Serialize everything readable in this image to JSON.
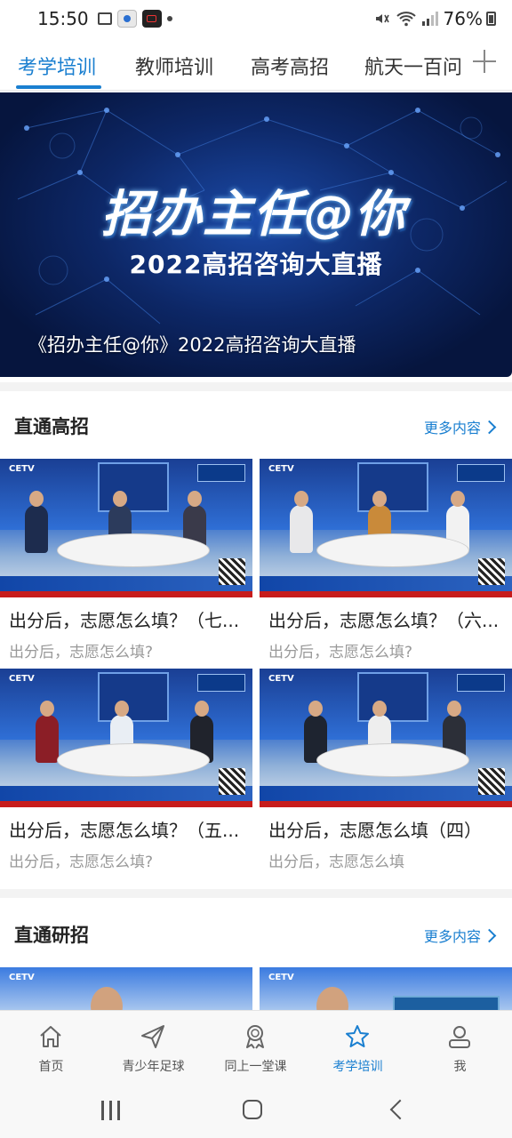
{
  "status_bar": {
    "time": "15:50",
    "battery": "76%",
    "icons": [
      "gallery-icon",
      "camera-app-icon",
      "screen-record-icon",
      "dot-icon",
      "mute-icon",
      "wifi-icon",
      "signal-icon",
      "battery-icon"
    ]
  },
  "tabs": {
    "items": [
      {
        "label": "考学培训",
        "active": true
      },
      {
        "label": "教师培训",
        "active": false
      },
      {
        "label": "高考高招",
        "active": false
      },
      {
        "label": "航天一百问",
        "active": false
      }
    ],
    "add_icon": "plus-icon",
    "accent": "#1a7fd0"
  },
  "banner": {
    "logo_text": "招办主任@你",
    "subtitle": "2022高招咨询大直播",
    "caption": "《招办主任@你》2022高招咨询大直播"
  },
  "sections": [
    {
      "title": "直通高招",
      "more_label": "更多内容",
      "cards": [
        {
          "title": "出分后，志愿怎么填？（七...",
          "subtitle": "出分后，志愿怎么填?"
        },
        {
          "title": "出分后，志愿怎么填？（六...",
          "subtitle": "出分后，志愿怎么填?"
        },
        {
          "title": "出分后，志愿怎么填？（五...",
          "subtitle": "出分后，志愿怎么填?"
        },
        {
          "title": "出分后，志愿怎么填（四）",
          "subtitle": "出分后，志愿怎么填"
        }
      ]
    },
    {
      "title": "直通研招",
      "more_label": "更多内容"
    }
  ],
  "bottom_nav": [
    {
      "label": "首页",
      "icon": "home-icon",
      "active": false
    },
    {
      "label": "青少年足球",
      "icon": "send-icon",
      "active": false
    },
    {
      "label": "同上一堂课",
      "icon": "award-icon",
      "active": false
    },
    {
      "label": "考学培训",
      "icon": "star-icon",
      "active": true
    },
    {
      "label": "我",
      "icon": "user-icon",
      "active": false
    }
  ]
}
